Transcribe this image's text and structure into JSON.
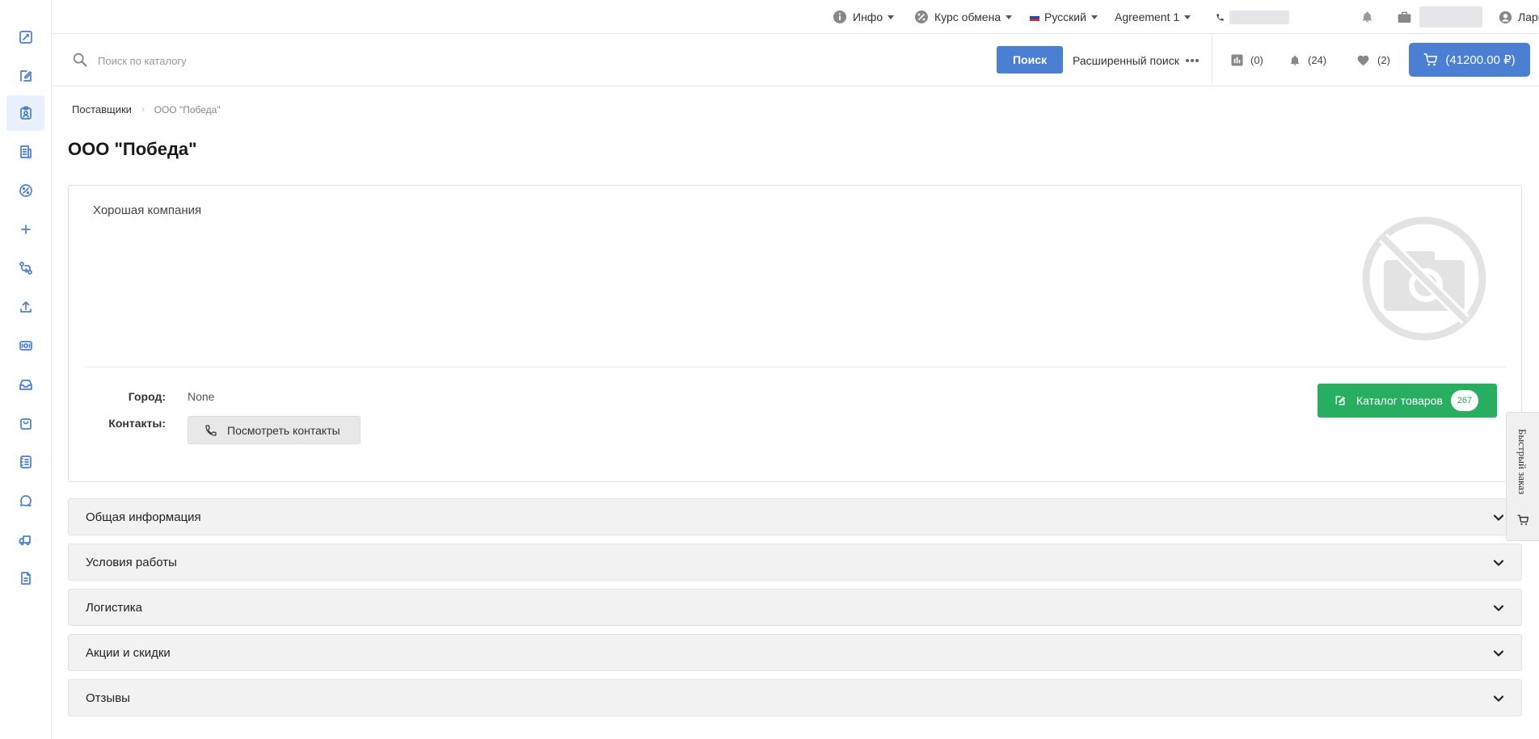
{
  "sidebar": {
    "items": [
      {
        "icon": "catalog-icon",
        "active": false
      },
      {
        "icon": "edit-catalog-icon",
        "active": false
      },
      {
        "icon": "suppliers-icon",
        "active": true
      },
      {
        "icon": "orders-icon",
        "active": false
      },
      {
        "icon": "percent-icon",
        "active": false
      },
      {
        "icon": "plus-icon",
        "active": false
      },
      {
        "icon": "exchange-icon",
        "active": false
      },
      {
        "icon": "upload-icon",
        "active": false
      },
      {
        "icon": "money-icon",
        "active": false
      },
      {
        "icon": "inbox-icon",
        "active": false
      },
      {
        "icon": "bag-icon",
        "active": false
      },
      {
        "icon": "documents-icon",
        "active": false
      },
      {
        "icon": "chat-icon",
        "active": false
      },
      {
        "icon": "delivery-icon",
        "active": false
      },
      {
        "icon": "file-icon",
        "active": false
      }
    ]
  },
  "topbar": {
    "info_label": "Инфо",
    "exchange_label": "Курс обмена",
    "language_label": "Русский",
    "agreement_label": "Agreement 1",
    "user_label": "Лариса В."
  },
  "search": {
    "placeholder": "Поиск по каталогу",
    "button_label": "Поиск",
    "advanced_label": "Расширенный поиск"
  },
  "counters": {
    "compare": "(0)",
    "notifications": "(24)",
    "favorites": "(2)",
    "cart": "(41200.00 ₽)"
  },
  "breadcrumb": {
    "parent": "Поставщики",
    "current": "ООО \"Победа\""
  },
  "page": {
    "title": "ООО \"Победа\""
  },
  "supplier": {
    "description": "Хорошая компания",
    "city_label": "Город:",
    "city_value": "None",
    "contacts_label": "Контакты:",
    "contacts_button": "Посмотреть контакты",
    "catalog_button": "Каталог товаров",
    "catalog_count": "267"
  },
  "accordion": [
    {
      "label": "Общая информация"
    },
    {
      "label": "Условия работы"
    },
    {
      "label": "Логистика"
    },
    {
      "label": "Акции и скидки"
    },
    {
      "label": "Отзывы"
    }
  ],
  "quick_order": {
    "label": "Быстрый заказ"
  },
  "colors": {
    "primary": "#4a7fd4",
    "success": "#27ae60",
    "sidebar_active": "#e9f0fb"
  }
}
